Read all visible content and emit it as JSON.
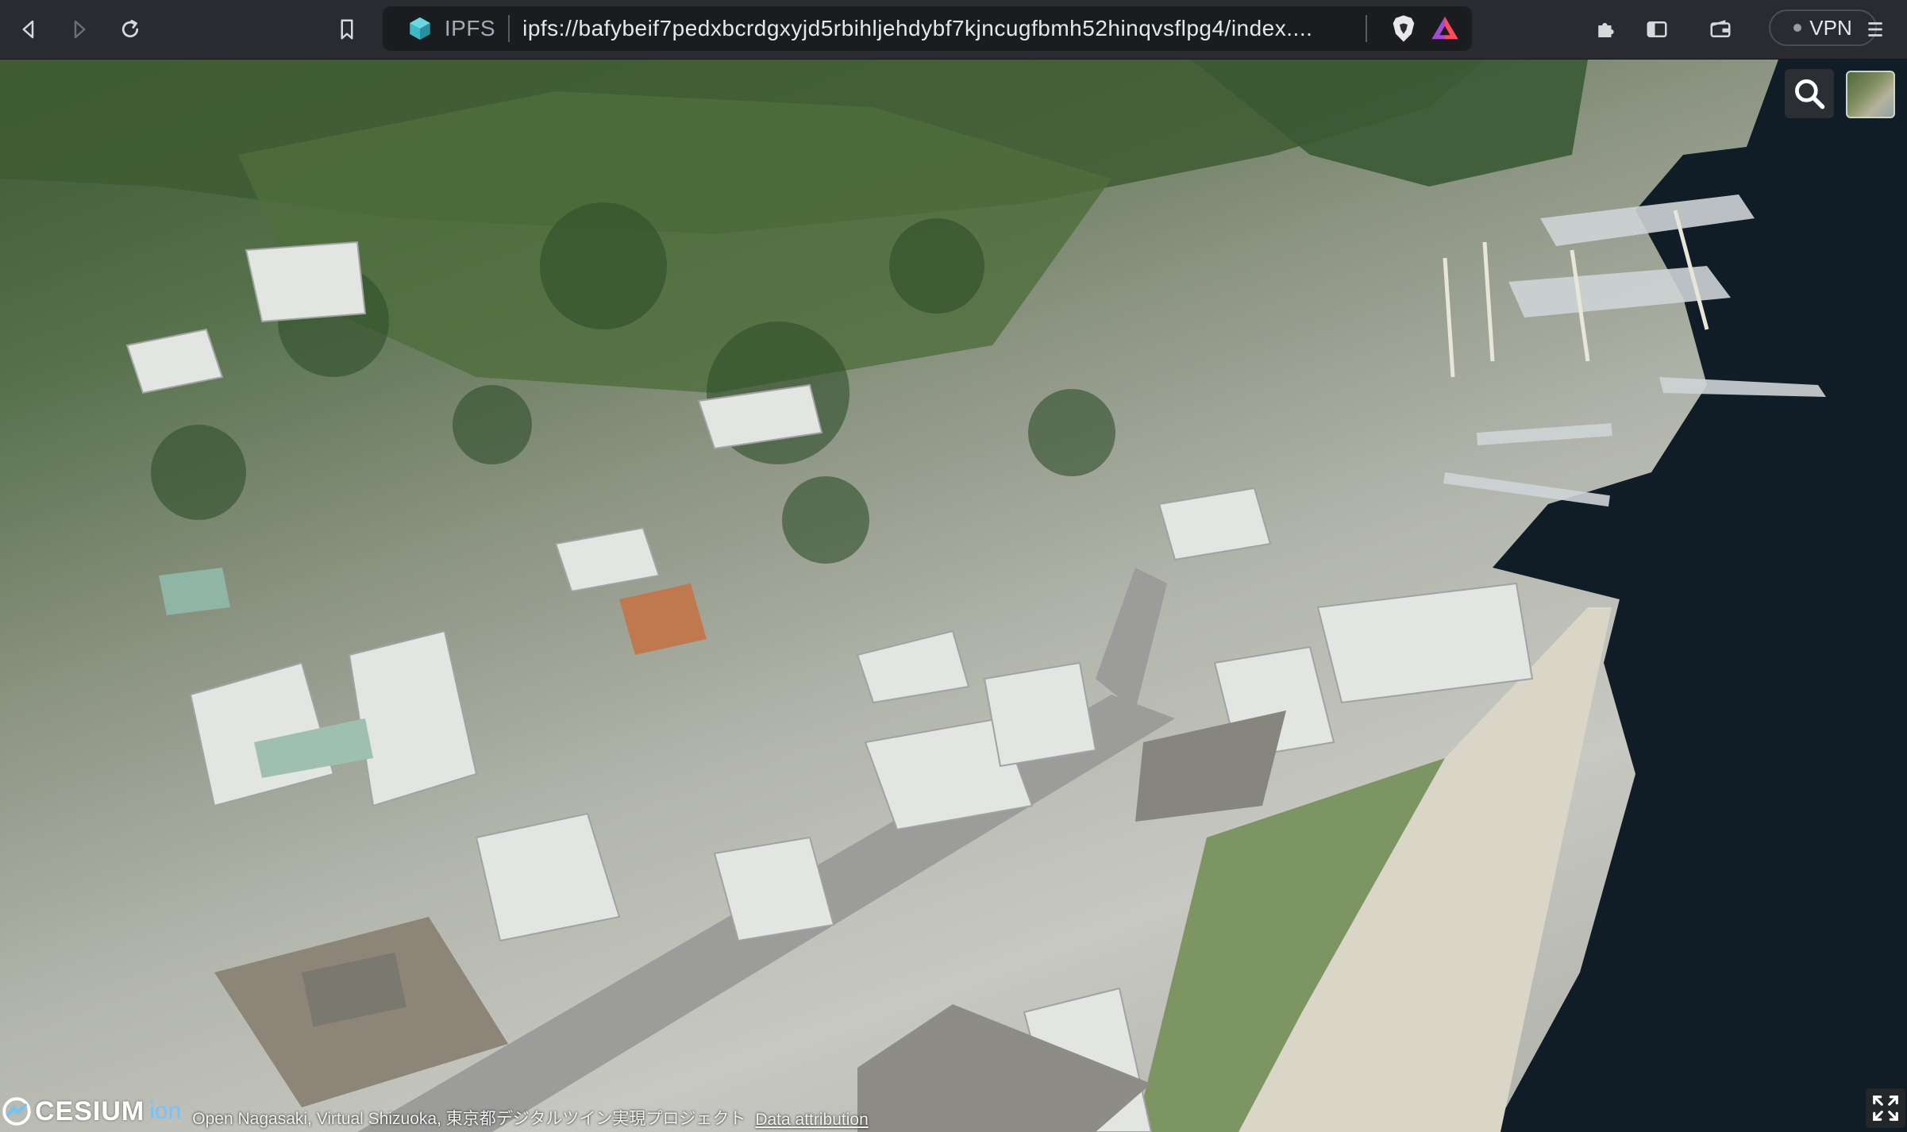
{
  "browser": {
    "site_label": "IPFS",
    "url": "ipfs://bafybeif7pedxbcrdgxyjd5rbihljehdybf7kjncugfbmh52hinqvsflpg4/index....",
    "vpn_label": "VPN",
    "icons": [
      "back-icon",
      "forward-icon",
      "reload-icon",
      "bookmark-icon",
      "ipfs-cube-icon",
      "brave-shields-icon",
      "brave-rewards-icon",
      "extensions-icon",
      "sidebar-icon",
      "wallet-icon",
      "menu-icon"
    ]
  },
  "viewer": {
    "logo_text": "CESIUM",
    "logo_suffix": "ion",
    "attribution": "Open Nagasaki, Virtual Shizuoka, 東京都デジタルツイン実現プロジェクト",
    "data_attribution": "Data attribution",
    "icons": [
      "search-icon",
      "base-layer-picker-icon",
      "fullscreen-icon"
    ]
  }
}
